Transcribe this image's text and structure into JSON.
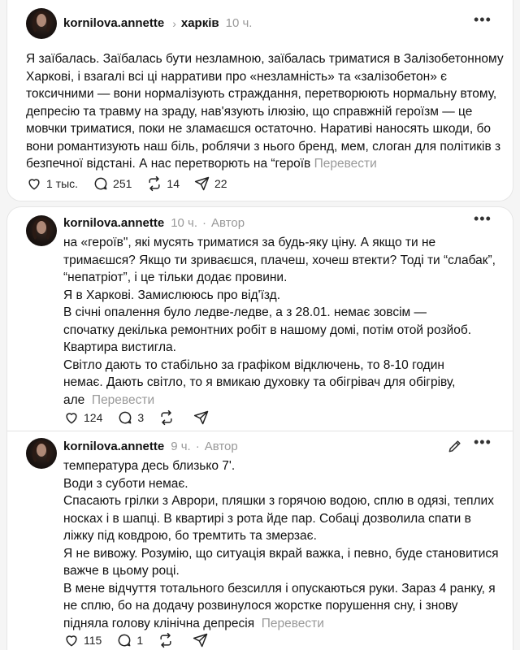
{
  "post": {
    "username": "kornilova.annette",
    "location": "харків",
    "time": "10 ч.",
    "lines": [
      "Я заїбалась. Заїбалась бути незламною, заїбалась триматися в Залізобетонному",
      "Харкові, і взагалі всі ці нарративи про «незламність» та «залізобетон» є",
      "токсичними — вони нормалізують страждання, перетворюють нормальну втому,",
      "депресію та травму на зраду, нав'язують ілюзію, що справжній героїзм — це",
      "мовчки триматися, поки не зламаєшся остаточно. Наративі наносять шкоди, бо",
      "вони романтизують наш біль, роблячи з нього бренд, мем, слоган для політиків з",
      "безпечної відстані. А нас перетворють на “героїв"
    ],
    "translate": "Перевести",
    "likes": "1 тыс.",
    "comments": "251",
    "reposts": "14",
    "shares": "22"
  },
  "reply1": {
    "username": "kornilova.annette",
    "time": "10 ч.",
    "author": "Автор",
    "lines": [
      "на «героїв\", які мусять триматися за будь-яку ціну. А якщо ти не",
      "тримаєшся? Якщо ти зриваєшся, плачеш, хочеш втекти? Тоді ти “слабак”,",
      "“непатріот”, і це тільки додає провини.",
      "Я в Харкові. Замислююсь про від'їзд.",
      "В січні опалення було ледве-ледве, а з 28.01. немає зовсім —",
      "спочатку декілька ремонтних робіт в нашому домі, потім отой розйоб.",
      "Квартира вистигла.",
      "Світло дають то стабільно за графіком відключень, то 8-10 годин",
      "немає. Дають світло, то я вмикаю духовку та обігрівач для обігріву,",
      "але"
    ],
    "translate": "Перевести",
    "likes": "124",
    "comments": "3"
  },
  "reply2": {
    "username": "kornilova.annette",
    "time": "9 ч.",
    "author": "Автор",
    "lines": [
      "температура десь близько 7'.",
      "Води з суботи немає.",
      "Спасають грілки з Аврори, пляшки з горячою водою, сплю в одязі, теплих",
      "носках і в шапці. В квартирі з рота йде пар. Собаці дозволила спати в",
      "ліжку під ковдрою, бо тремтить та змерзає.",
      "Я не вивожу. Розумію, що ситуація вкрай важка, і певно, буде становитися",
      "важче в цьому році.",
      "В мене відчуття тотального безсилля і опускаються руки. Зараз 4 ранку, я",
      "не сплю, бо на додачу розвинулося жорстке порушення сну, і знову",
      "підняла голову клінічна депресія"
    ],
    "translate": "Перевести",
    "likes": "115",
    "comments": "1"
  }
}
